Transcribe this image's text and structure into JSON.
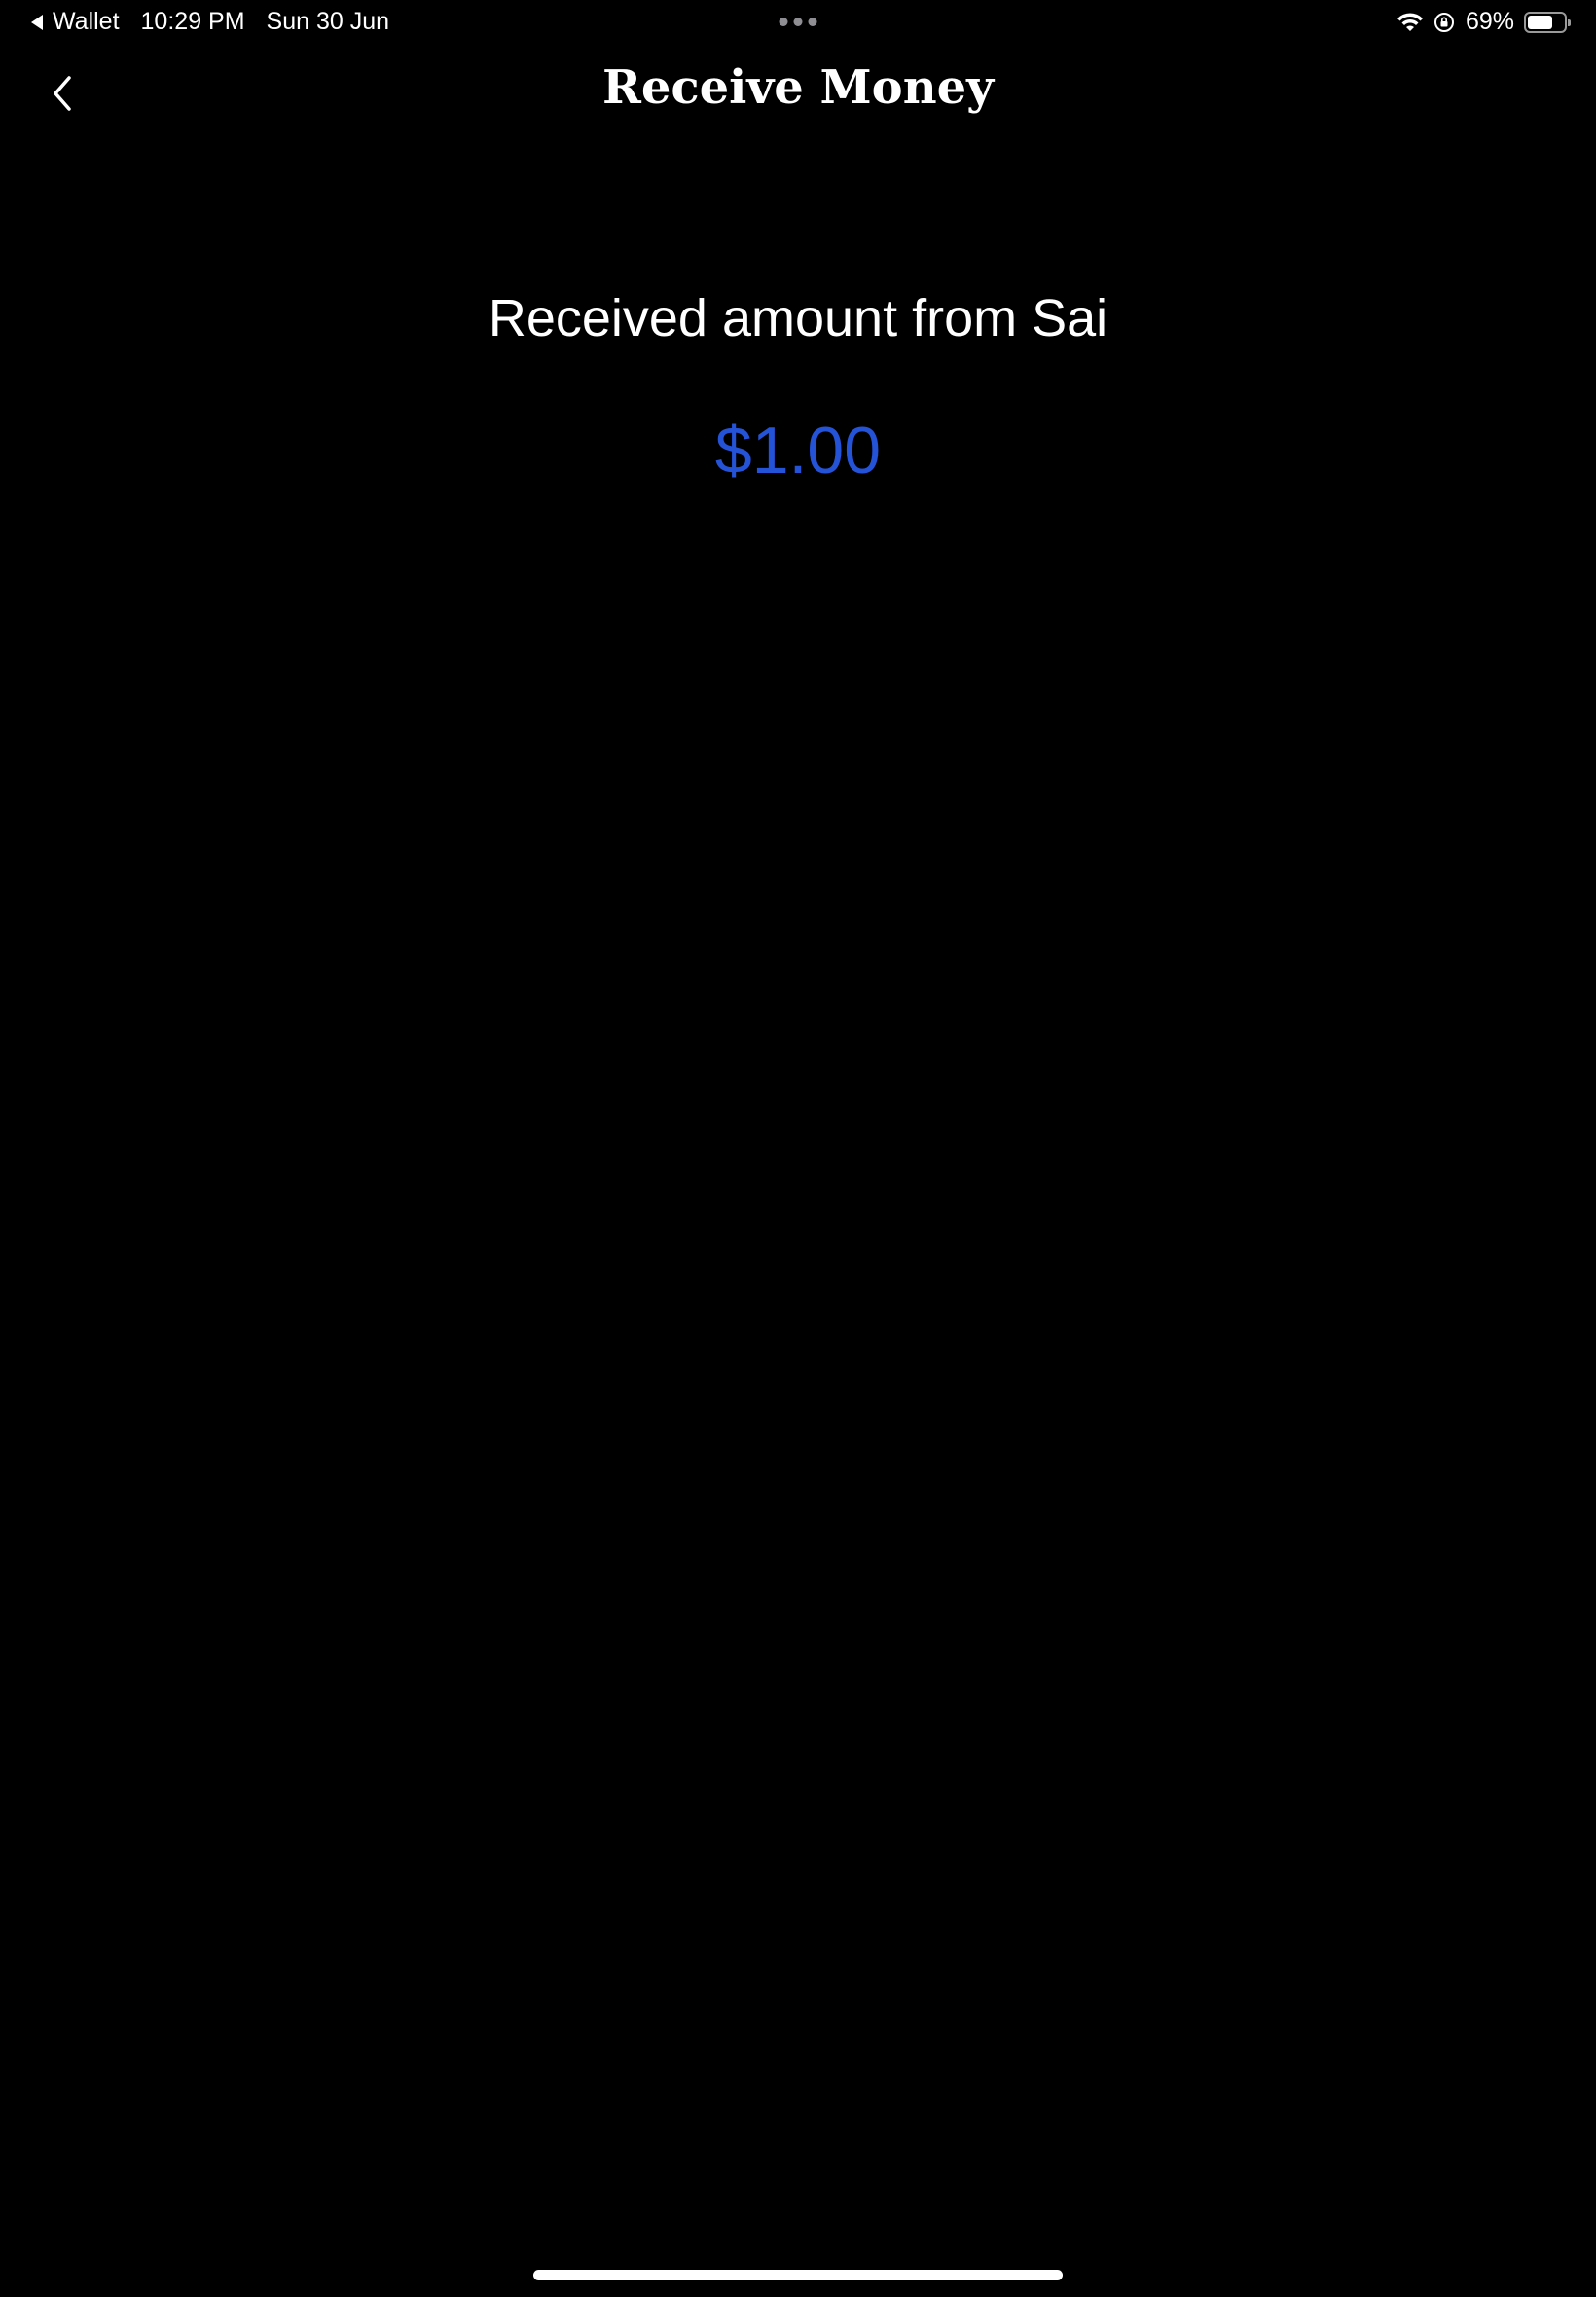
{
  "status_bar": {
    "back_app": "Wallet",
    "time": "10:29 PM",
    "date": "Sun 30 Jun",
    "battery_text": "69%",
    "battery_level": 0.69
  },
  "nav": {
    "title": "Receive Money",
    "back_icon": "chevron-left-icon"
  },
  "content": {
    "received_label": "Received amount from Sai",
    "amount": "$1.00"
  },
  "colors": {
    "background": "#000000",
    "text": "#ffffff",
    "amount": "#2553d8"
  }
}
